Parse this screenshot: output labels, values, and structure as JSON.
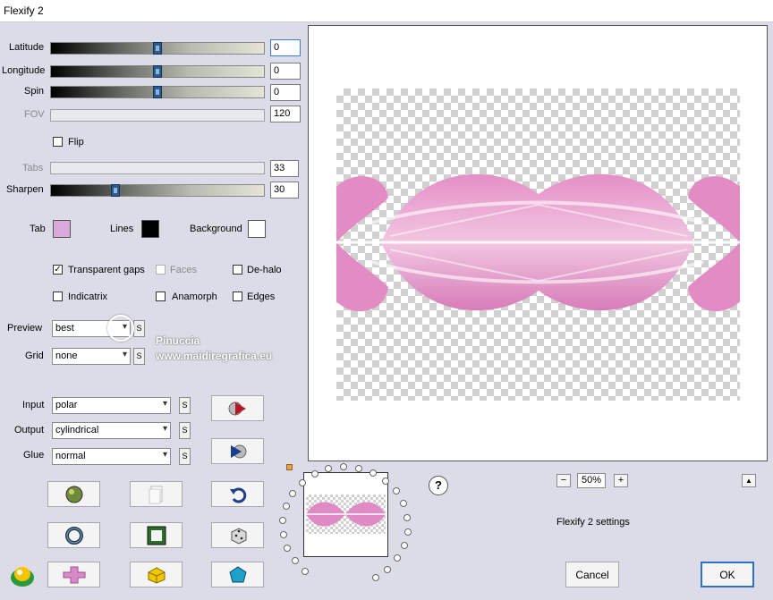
{
  "window": {
    "title": "Flexify 2"
  },
  "sliders": {
    "latitude": {
      "label": "Latitude",
      "value": "0"
    },
    "longitude": {
      "label": "Longitude",
      "value": "0"
    },
    "spin": {
      "label": "Spin",
      "value": "0"
    },
    "fov": {
      "label": "FOV",
      "value": "120"
    },
    "tabs": {
      "label": "Tabs",
      "value": "33"
    },
    "sharpen": {
      "label": "Sharpen",
      "value": "30"
    }
  },
  "flip": {
    "label": "Flip",
    "checked": false
  },
  "colors": {
    "tab": {
      "label": "Tab",
      "color": "#dba8dc"
    },
    "lines": {
      "label": "Lines",
      "color": "#000000"
    },
    "background": {
      "label": "Background",
      "color": "#ffffff"
    }
  },
  "options": {
    "transparent_gaps": {
      "label": "Transparent gaps",
      "checked": true
    },
    "faces": {
      "label": "Faces",
      "checked": false
    },
    "de_halo": {
      "label": "De-halo",
      "checked": false
    },
    "indicatrix": {
      "label": "Indicatrix",
      "checked": false
    },
    "anamorph": {
      "label": "Anamorph",
      "checked": false
    },
    "edges": {
      "label": "Edges",
      "checked": false
    }
  },
  "preview_mode": {
    "label": "Preview",
    "value": "best"
  },
  "grid": {
    "label": "Grid",
    "value": "none"
  },
  "input": {
    "label": "Input",
    "value": "polar"
  },
  "output": {
    "label": "Output",
    "value": "cylindrical"
  },
  "glue": {
    "label": "Glue",
    "value": "normal"
  },
  "s_button": "S",
  "zoom": {
    "value": "50%",
    "minus": "−",
    "plus": "+"
  },
  "settings_label": "Flexify 2 settings",
  "help": "?",
  "collapse": "▲",
  "buttons": {
    "cancel": "Cancel",
    "ok": "OK"
  },
  "watermark": {
    "name": "Pinuccia",
    "site": "www.maidiregrafica.eu"
  },
  "accent": "#e087c3"
}
